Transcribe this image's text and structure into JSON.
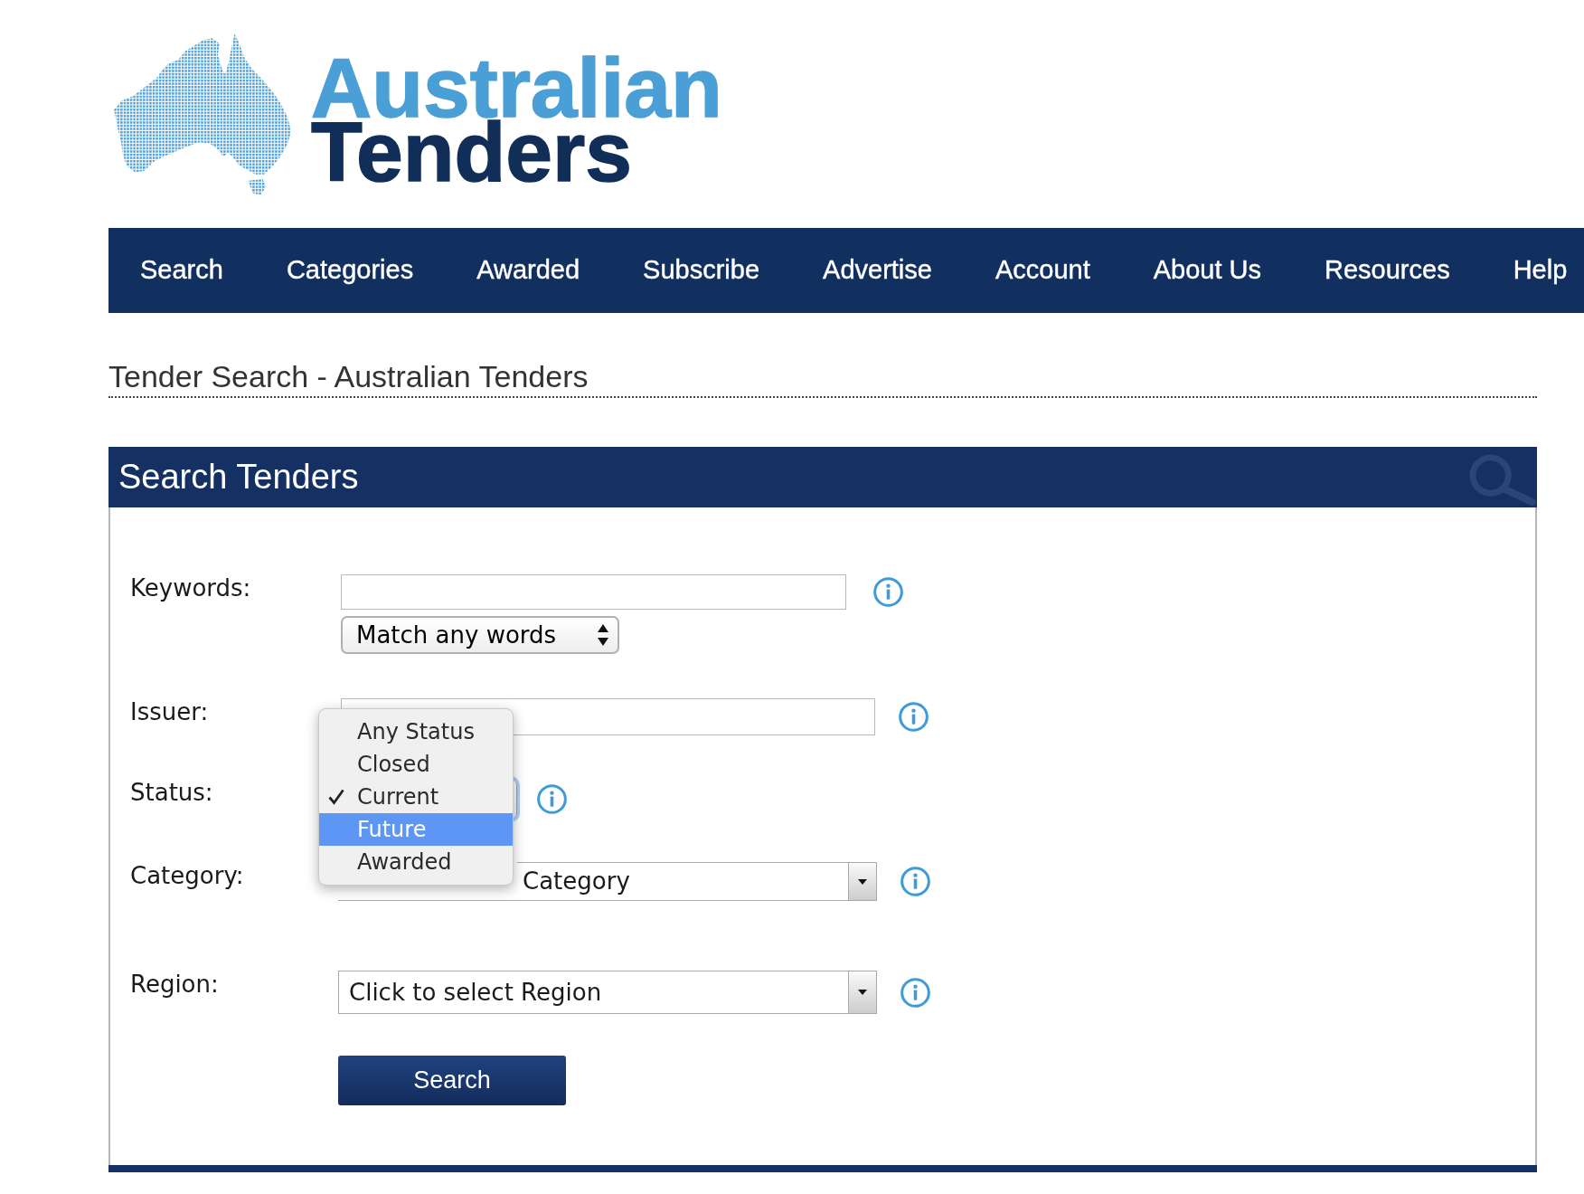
{
  "logo": {
    "line_1": "Australian",
    "line_2": "Tenders"
  },
  "nav": {
    "items": [
      "Search",
      "Categories",
      "Awarded",
      "Subscribe",
      "Advertise",
      "Account",
      "About Us",
      "Resources",
      "Help"
    ]
  },
  "page_title": "Tender Search - Australian Tenders",
  "search_panel": {
    "title": "Search Tenders",
    "keywords": {
      "label": "Keywords:",
      "match_select": {
        "value": "Match any words"
      }
    },
    "issuer": {
      "label": "Issuer:"
    },
    "status": {
      "label": "Status:",
      "expanded": true,
      "options": [
        {
          "label": "Any Status",
          "selected": false,
          "highlighted": false
        },
        {
          "label": "Closed",
          "selected": false,
          "highlighted": false
        },
        {
          "label": "Current",
          "selected": true,
          "highlighted": false
        },
        {
          "label": "Future",
          "selected": false,
          "highlighted": true
        },
        {
          "label": "Awarded",
          "selected": false,
          "highlighted": false
        }
      ]
    },
    "category": {
      "label": "Category:",
      "value": "Category"
    },
    "region": {
      "label": "Region:",
      "value": "Click to select Region"
    },
    "search_button": "Search"
  }
}
